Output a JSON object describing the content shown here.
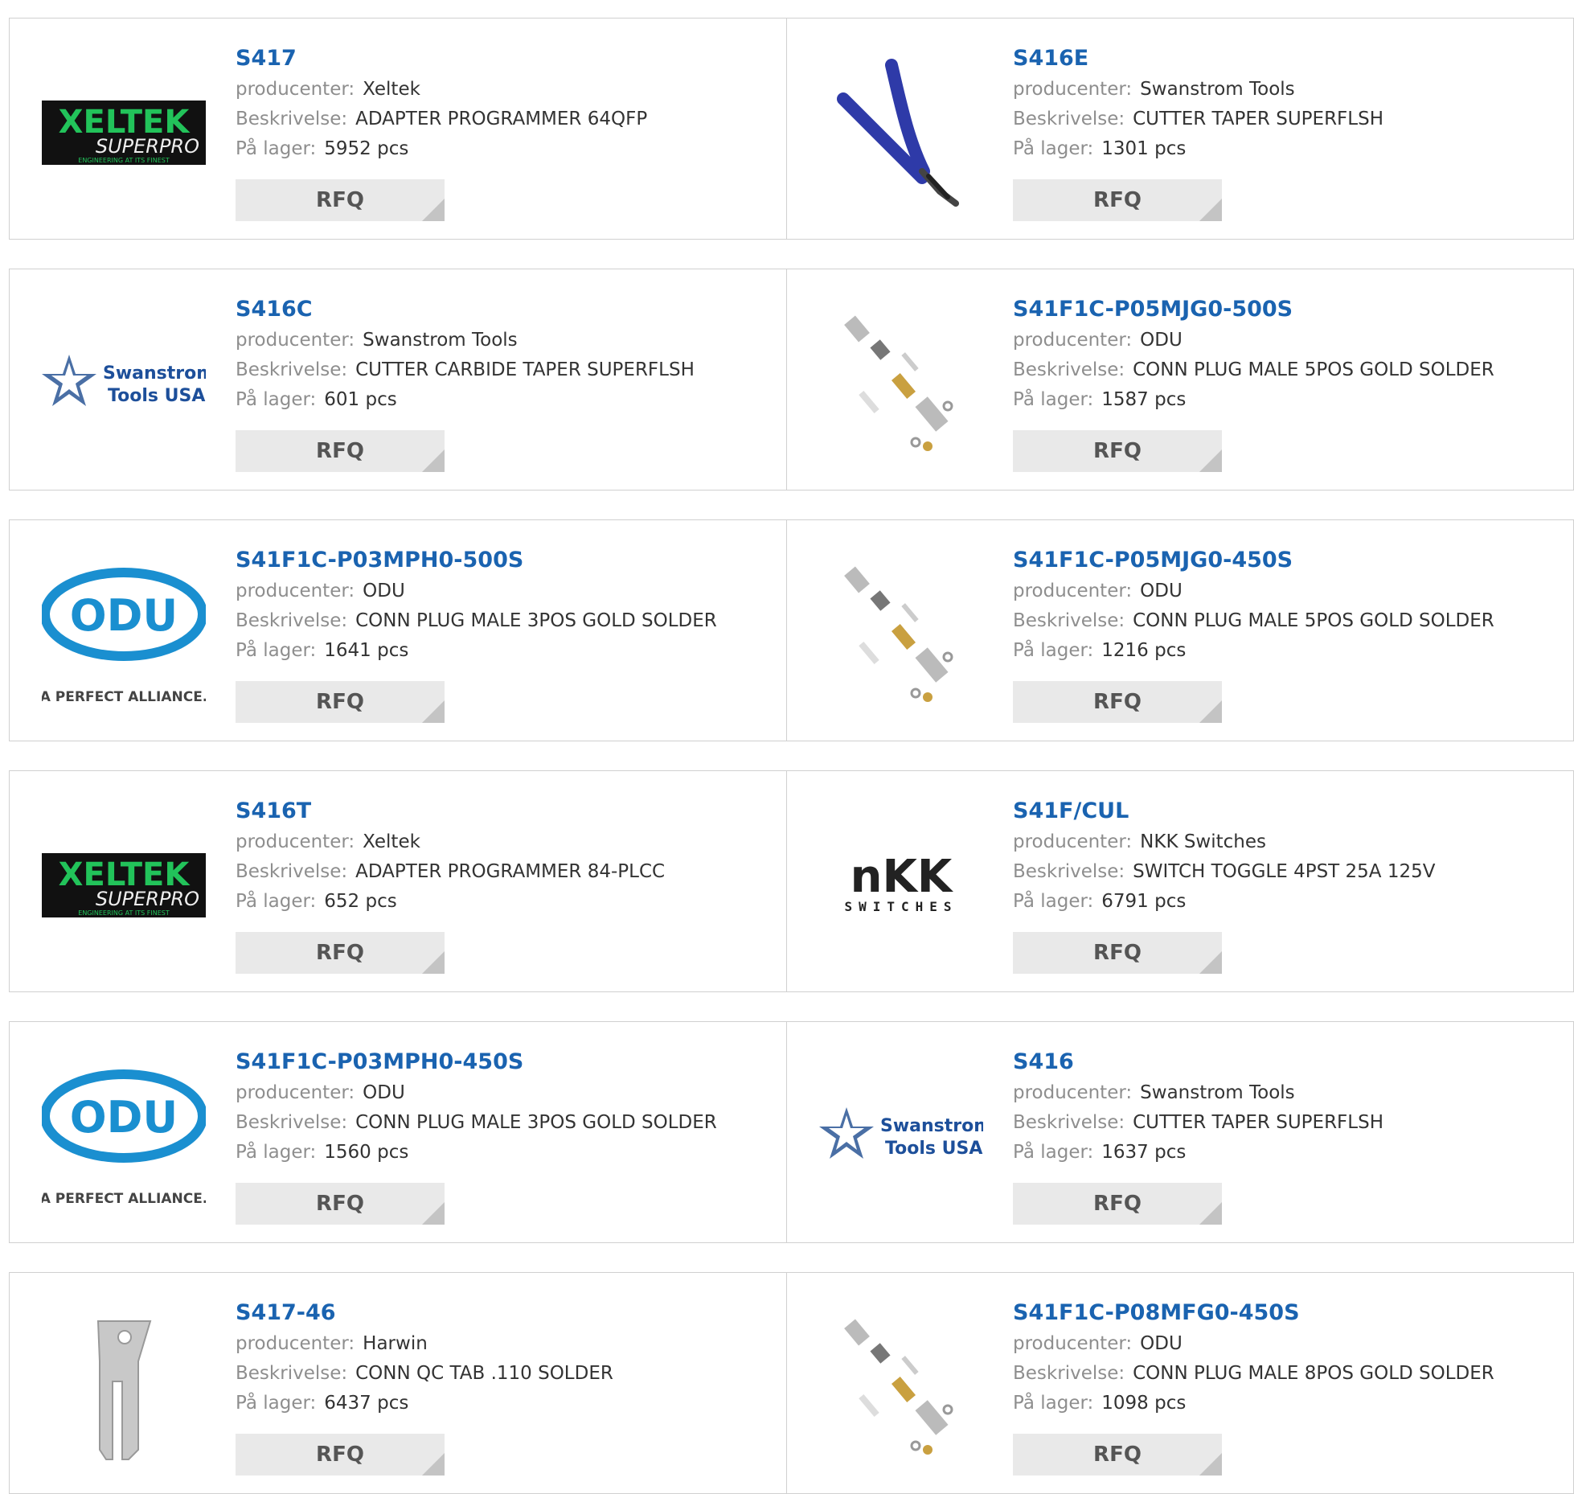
{
  "labels": {
    "manufacturer": "producenter:",
    "description": "Beskrivelse:",
    "stock": "På lager:",
    "rfq": "RFQ"
  },
  "colors": {
    "link": "#1a63b0",
    "label": "#8e8e8e",
    "value": "#333333",
    "button_bg": "#e9e9e9"
  },
  "products": [
    {
      "part": "S417",
      "manufacturer": "Xeltek",
      "description": "ADAPTER PROGRAMMER 64QFP",
      "stock": "5952 pcs",
      "image": "xeltek-logo"
    },
    {
      "part": "S416E",
      "manufacturer": "Swanstrom Tools",
      "description": "CUTTER TAPER SUPERFLSH",
      "stock": "1301 pcs",
      "image": "cutter-photo"
    },
    {
      "part": "S416C",
      "manufacturer": "Swanstrom Tools",
      "description": "CUTTER CARBIDE TAPER SUPERFLSH",
      "stock": "601 pcs",
      "image": "swanstrom-logo"
    },
    {
      "part": "S41F1C-P05MJG0-500S",
      "manufacturer": "ODU",
      "description": "CONN PLUG MALE 5POS GOLD SOLDER",
      "stock": "1587 pcs",
      "image": "connector-photo"
    },
    {
      "part": "S41F1C-P03MPH0-500S",
      "manufacturer": "ODU",
      "description": "CONN PLUG MALE 3POS GOLD SOLDER",
      "stock": "1641 pcs",
      "image": "odu-logo"
    },
    {
      "part": "S41F1C-P05MJG0-450S",
      "manufacturer": "ODU",
      "description": "CONN PLUG MALE 5POS GOLD SOLDER",
      "stock": "1216 pcs",
      "image": "connector-photo"
    },
    {
      "part": "S416T",
      "manufacturer": "Xeltek",
      "description": "ADAPTER PROGRAMMER 84-PLCC",
      "stock": "652 pcs",
      "image": "xeltek-logo"
    },
    {
      "part": "S41F/CUL",
      "manufacturer": "NKK Switches",
      "description": "SWITCH TOGGLE 4PST 25A 125V",
      "stock": "6791 pcs",
      "image": "nkk-logo"
    },
    {
      "part": "S41F1C-P03MPH0-450S",
      "manufacturer": "ODU",
      "description": "CONN PLUG MALE 3POS GOLD SOLDER",
      "stock": "1560 pcs",
      "image": "odu-logo"
    },
    {
      "part": "S416",
      "manufacturer": "Swanstrom Tools",
      "description": "CUTTER TAPER SUPERFLSH",
      "stock": "1637 pcs",
      "image": "swanstrom-logo"
    },
    {
      "part": "S417-46",
      "manufacturer": "Harwin",
      "description": "CONN QC TAB .110 SOLDER",
      "stock": "6437 pcs",
      "image": "tab-photo"
    },
    {
      "part": "S41F1C-P08MFG0-450S",
      "manufacturer": "ODU",
      "description": "CONN PLUG MALE 8POS GOLD SOLDER",
      "stock": "1098 pcs",
      "image": "connector-photo"
    }
  ],
  "logo_text": {
    "xeltek": [
      "XELTEK",
      "SUPERPRO",
      "ENGINEERING AT ITS FINEST"
    ],
    "swanstrom": [
      "Swanstrom",
      "Tools USA"
    ],
    "odu": [
      "ODU",
      "A PERFECT ALLIANCE."
    ],
    "nkk": [
      "nKK",
      "SWITCHES"
    ]
  }
}
